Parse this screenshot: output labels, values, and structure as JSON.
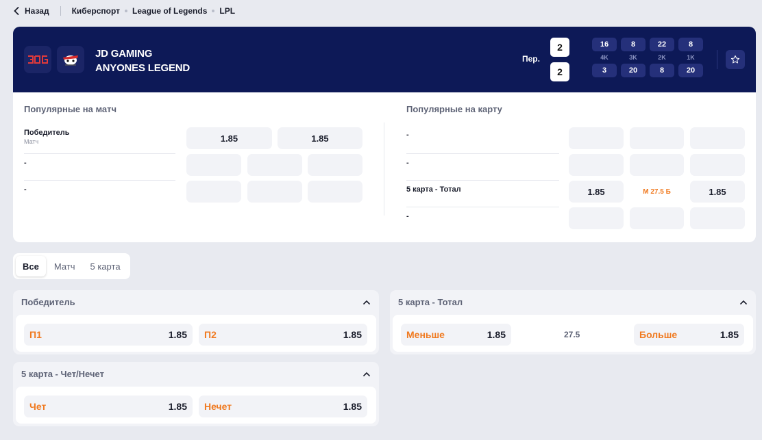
{
  "breadcrumb": {
    "back": "Назад",
    "items": [
      "Киберспорт",
      "League of Legends",
      "LPL"
    ]
  },
  "match": {
    "team1": "JD GAMING",
    "team2": "ANYONES LEGEND",
    "period_label": "Пер.",
    "score1": "2",
    "score2": "2",
    "stats": {
      "top": [
        "16",
        "8",
        "22",
        "8"
      ],
      "labels": [
        "4K",
        "3K",
        "2K",
        "1K"
      ],
      "bottom": [
        "3",
        "20",
        "8",
        "20"
      ]
    }
  },
  "popular": {
    "match_title": "Популярные на матч",
    "map_title": "Популярные на карту",
    "match_rows": [
      {
        "label": "Победитель",
        "sub": "Матч",
        "odds": [
          "1.85",
          "1.85"
        ]
      },
      {
        "label": "-",
        "sub": ""
      },
      {
        "label": "-",
        "sub": ""
      }
    ],
    "map_rows": [
      {
        "label": "-"
      },
      {
        "label": "-"
      },
      {
        "label": "5 карта - Тотал",
        "odds": [
          "1.85",
          "М 27.5 Б",
          "1.85"
        ]
      },
      {
        "label": "-"
      }
    ]
  },
  "tabs": [
    "Все",
    "Матч",
    "5 карта"
  ],
  "markets": {
    "winner": {
      "title": "Победитель",
      "outcomes": [
        {
          "name": "П1",
          "odd": "1.85"
        },
        {
          "name": "П2",
          "odd": "1.85"
        }
      ]
    },
    "total": {
      "title": "5 карта - Тотал",
      "under": {
        "name": "Меньше",
        "odd": "1.85"
      },
      "line": "27.5",
      "over": {
        "name": "Больше",
        "odd": "1.85"
      }
    },
    "odd_even": {
      "title": "5 карта - Чет/Нечет",
      "outcomes": [
        {
          "name": "Чет",
          "odd": "1.85"
        },
        {
          "name": "Нечет",
          "odd": "1.85"
        }
      ]
    }
  },
  "colors": {
    "accent": "#f07a20",
    "header": "#0d1957"
  }
}
